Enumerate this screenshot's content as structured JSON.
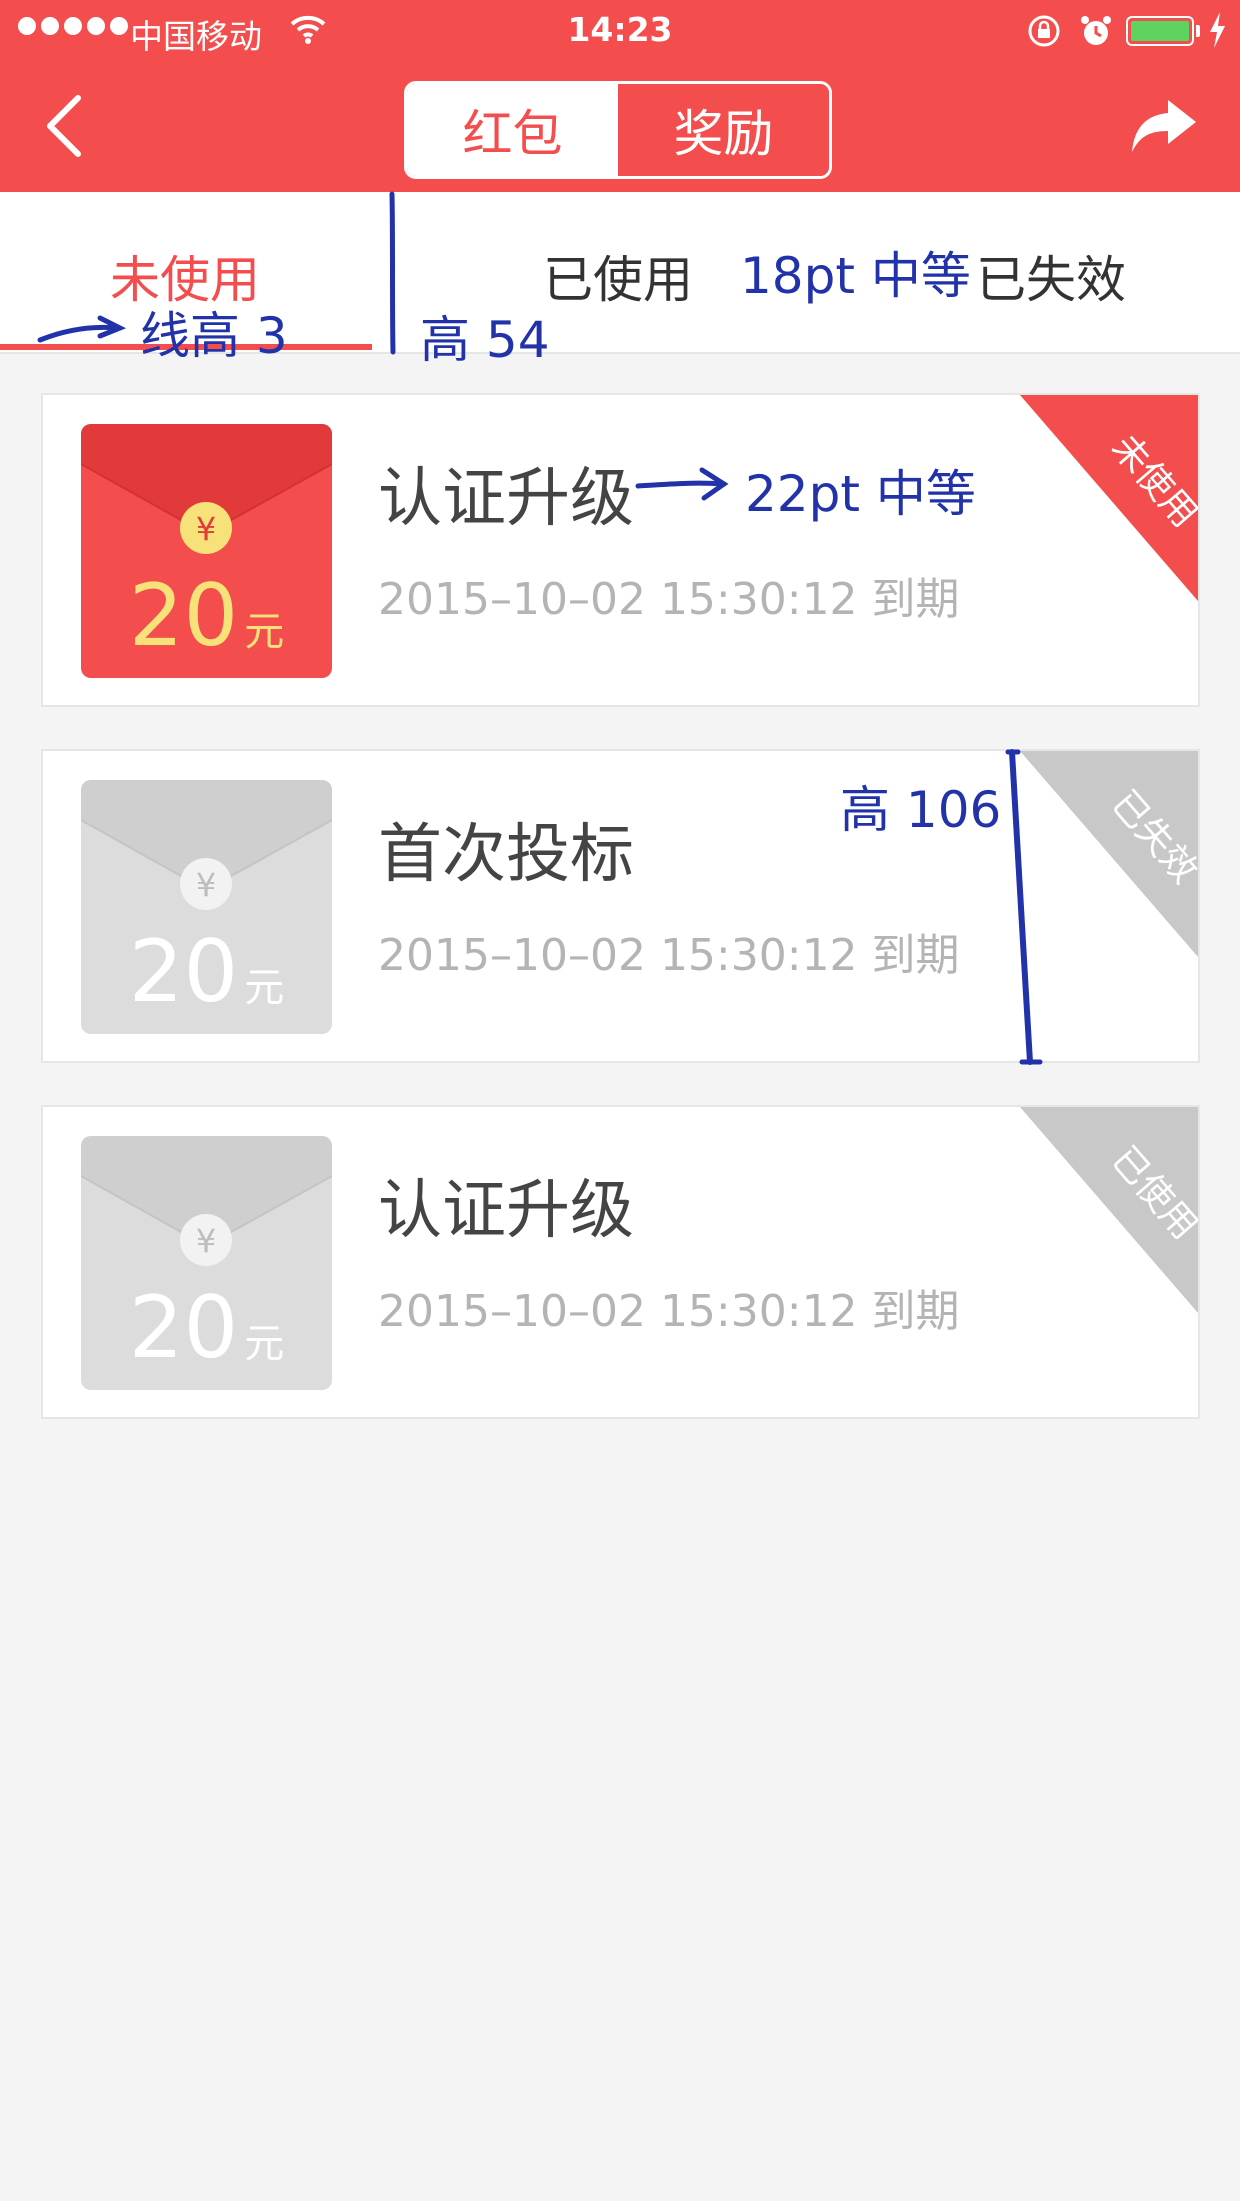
{
  "status_bar": {
    "carrier": "中国移动",
    "time": "14:23"
  },
  "nav": {
    "segments": [
      "红包",
      "奖励"
    ],
    "active_segment": "红包"
  },
  "tabs": {
    "items": [
      "未使用",
      "已使用",
      "已失效"
    ],
    "active": "未使用"
  },
  "cards": [
    {
      "title": "认证升级",
      "amount": "20",
      "unit": "元",
      "currency_symbol": "¥",
      "expiry": "2015–10–02   15:30:12 到期",
      "status_badge": "未使用",
      "status_color": "#f44d4d"
    },
    {
      "title": "首次投标",
      "amount": "20",
      "unit": "元",
      "currency_symbol": "¥",
      "expiry": "2015–10–02   15:30:12 到期",
      "status_badge": "已失效",
      "status_color": "#c8c8c8"
    },
    {
      "title": "认证升级",
      "amount": "20",
      "unit": "元",
      "currency_symbol": "¥",
      "expiry": "2015–10–02   15:30:12 到期",
      "status_badge": "已使用",
      "status_color": "#c8c8c8"
    }
  ],
  "annotations": {
    "underline_height": "线高 3",
    "tab_height": "高 54",
    "tab_font": "18pt 中等",
    "title_font": "22pt 中等",
    "card_height": "高 106"
  },
  "colors": {
    "accent": "#f44d4d",
    "annotation": "#2233aa"
  }
}
